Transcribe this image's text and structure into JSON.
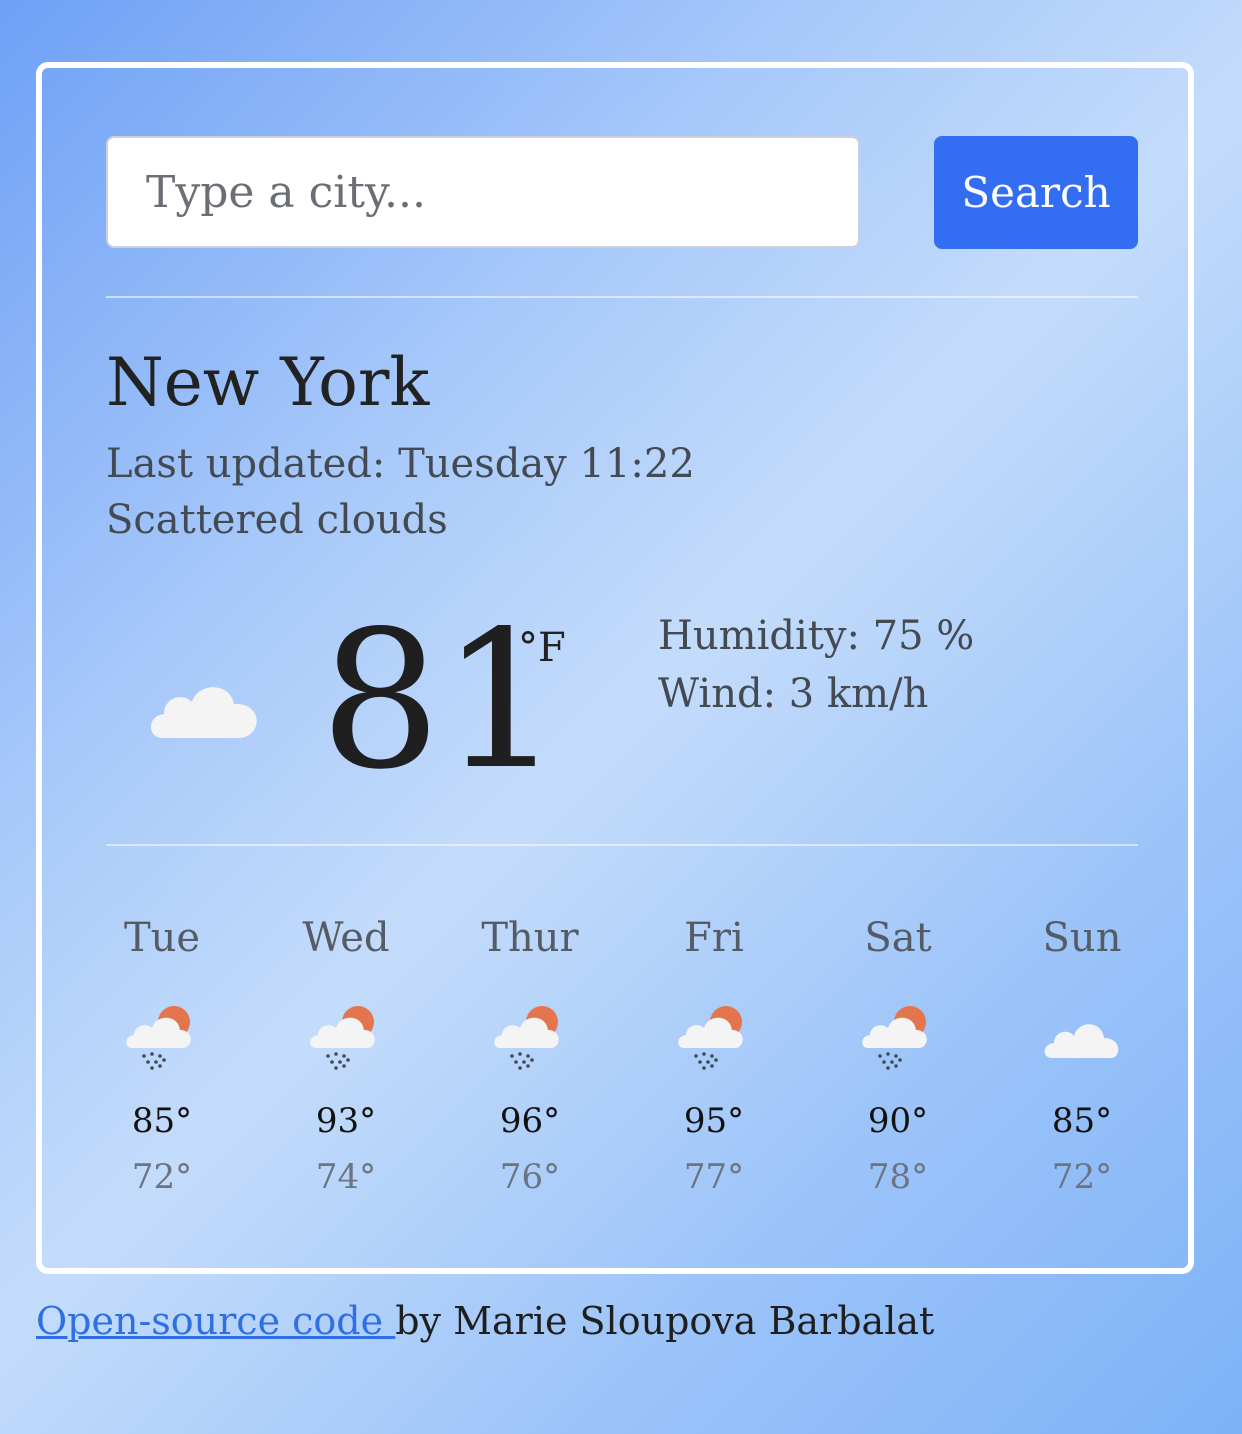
{
  "search": {
    "placeholder": "Type a city...",
    "value": "",
    "button_label": "Search"
  },
  "current": {
    "city": "New York",
    "last_updated": "Last updated: Tuesday 11:22",
    "description": "Scattered clouds",
    "icon": "cloud-icon",
    "temperature": "81",
    "unit": "°F",
    "humidity": "Humidity: 75 %",
    "wind": "Wind: 3 km/h"
  },
  "forecast": [
    {
      "day": "Tue",
      "icon": "rain-sun-cloud-icon",
      "max": "85°",
      "min": "72°"
    },
    {
      "day": "Wed",
      "icon": "rain-sun-cloud-icon",
      "max": "93°",
      "min": "74°"
    },
    {
      "day": "Thur",
      "icon": "rain-sun-cloud-icon",
      "max": "96°",
      "min": "76°"
    },
    {
      "day": "Fri",
      "icon": "rain-sun-cloud-icon",
      "max": "95°",
      "min": "77°"
    },
    {
      "day": "Sat",
      "icon": "rain-sun-cloud-icon",
      "max": "90°",
      "min": "78°"
    },
    {
      "day": "Sun",
      "icon": "cloud-icon",
      "max": "85°",
      "min": "72°"
    }
  ],
  "footer": {
    "link_text": "Open-source code ",
    "credit": "by Marie Sloupova Barbalat"
  },
  "colors": {
    "button": "#336ef2",
    "link": "#2f6fe4",
    "card_border": "#ffffff",
    "sun": "#e4764f"
  }
}
